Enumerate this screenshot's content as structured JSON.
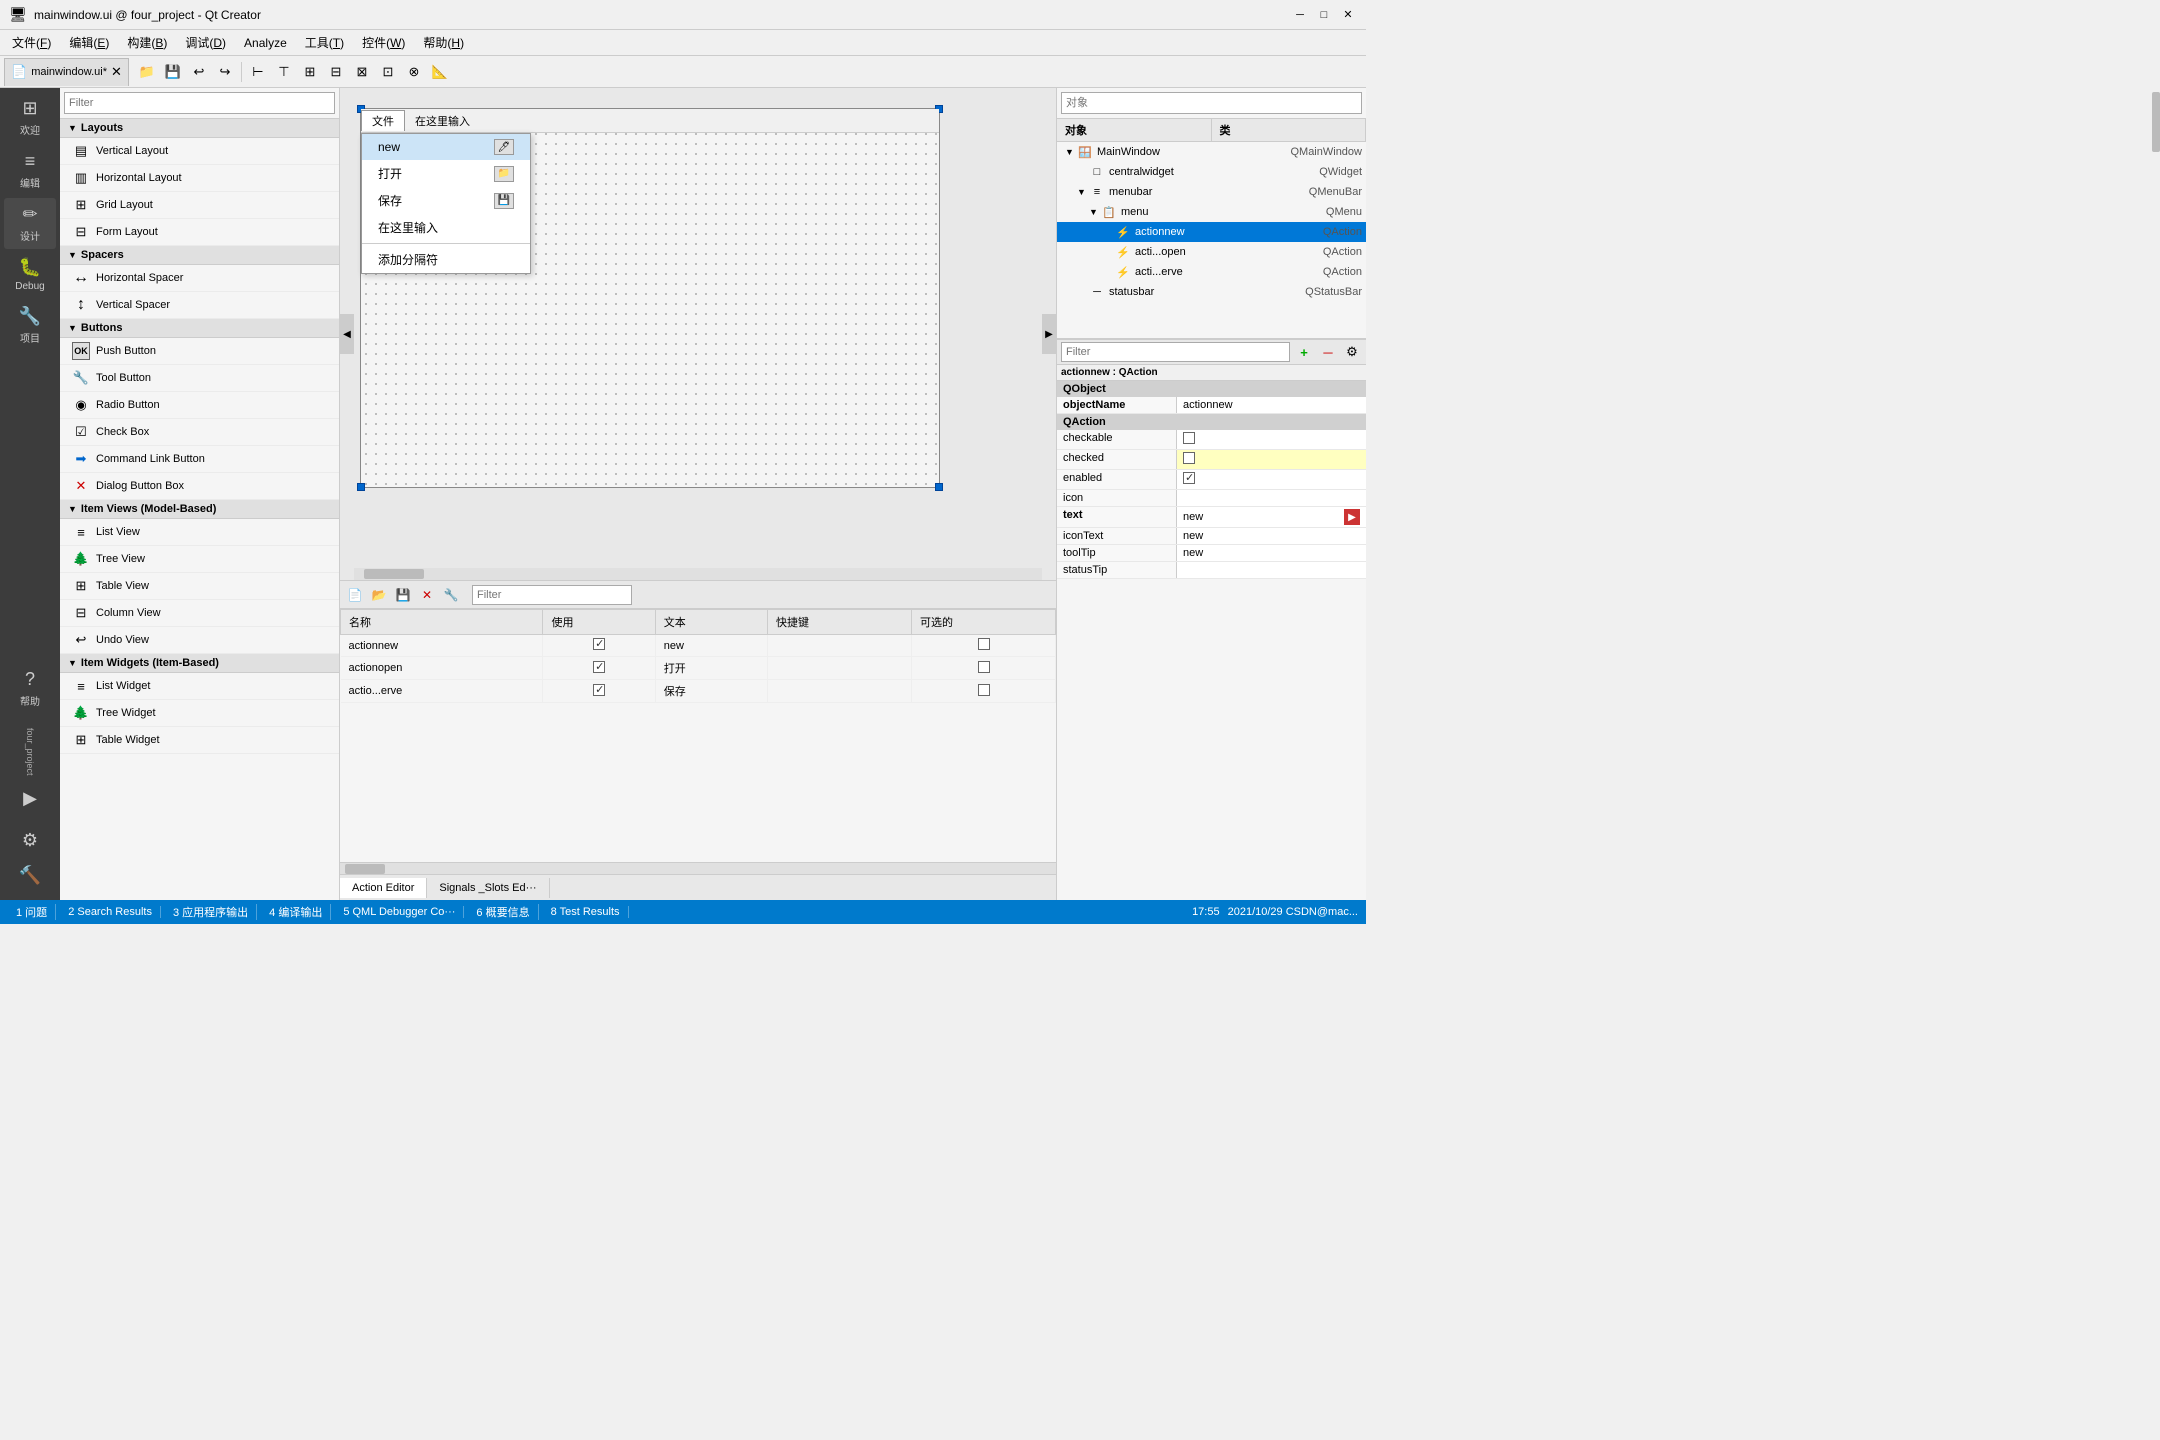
{
  "titleBar": {
    "title": "mainwindow.ui @ four_project - Qt Creator",
    "minimize": "─",
    "maximize": "□",
    "close": "✕"
  },
  "menuBar": {
    "items": [
      {
        "label": "文件(F)",
        "underline": "F"
      },
      {
        "label": "编辑(E)",
        "underline": "E"
      },
      {
        "label": "构建(B)",
        "underline": "B"
      },
      {
        "label": "调试(D)",
        "underline": "D"
      },
      {
        "label": "Analyze",
        "underline": ""
      },
      {
        "label": "工具(T)",
        "underline": "T"
      },
      {
        "label": "控件(W)",
        "underline": "W"
      },
      {
        "label": "帮助(H)",
        "underline": "H"
      }
    ]
  },
  "docTab": {
    "label": "mainwindow.ui*",
    "modified": true
  },
  "sidebarIcons": [
    {
      "name": "welcome",
      "symbol": "⊞",
      "label": "欢迎"
    },
    {
      "name": "edit",
      "symbol": "≡",
      "label": "编辑"
    },
    {
      "name": "design",
      "symbol": "✏",
      "label": "设计"
    },
    {
      "name": "debug",
      "symbol": "🐛",
      "label": "Debug"
    },
    {
      "name": "project",
      "symbol": "🔧",
      "label": "项目"
    },
    {
      "name": "help",
      "symbol": "?",
      "label": "帮助"
    }
  ],
  "widgetPanel": {
    "filterPlaceholder": "Filter",
    "categories": [
      {
        "name": "Layouts",
        "items": [
          {
            "label": "Vertical Layout",
            "icon": "▤"
          },
          {
            "label": "Horizontal Layout",
            "icon": "▥"
          },
          {
            "label": "Grid Layout",
            "icon": "⊞"
          },
          {
            "label": "Form Layout",
            "icon": "⊟"
          }
        ]
      },
      {
        "name": "Spacers",
        "items": [
          {
            "label": "Horizontal Spacer",
            "icon": "↔"
          },
          {
            "label": "Vertical Spacer",
            "icon": "↕"
          }
        ]
      },
      {
        "name": "Buttons",
        "items": [
          {
            "label": "Push Button",
            "icon": "OK"
          },
          {
            "label": "Tool Button",
            "icon": "🔧"
          },
          {
            "label": "Radio Button",
            "icon": "◉"
          },
          {
            "label": "Check Box",
            "icon": "☑"
          },
          {
            "label": "Command Link Button",
            "icon": "➡"
          },
          {
            "label": "Dialog Button Box",
            "icon": "✕"
          }
        ]
      },
      {
        "name": "Item Views (Model-Based)",
        "items": [
          {
            "label": "List View",
            "icon": "≡"
          },
          {
            "label": "Tree View",
            "icon": "🌲"
          },
          {
            "label": "Table View",
            "icon": "⊞"
          },
          {
            "label": "Column View",
            "icon": "⊟"
          },
          {
            "label": "Undo View",
            "icon": "↩"
          }
        ]
      },
      {
        "name": "Item Widgets (Item-Based)",
        "items": [
          {
            "label": "List Widget",
            "icon": "≡"
          },
          {
            "label": "Tree Widget",
            "icon": "🌲"
          },
          {
            "label": "Table Widget",
            "icon": "⊞"
          }
        ]
      }
    ]
  },
  "canvas": {
    "menuTabs": [
      {
        "label": "文件",
        "active": true
      },
      {
        "label": "在这里输入",
        "active": false
      }
    ],
    "dropdown": {
      "items": [
        {
          "label": "new",
          "shortcut": "",
          "hasIcon": true,
          "separator": false
        },
        {
          "label": "打开",
          "shortcut": "",
          "hasIcon": true,
          "separator": false
        },
        {
          "label": "保存",
          "shortcut": "",
          "hasIcon": true,
          "separator": false
        },
        {
          "label": "在这里输入",
          "shortcut": "",
          "hasIcon": false,
          "separator": false
        },
        {
          "label": "添加分隔符",
          "shortcut": "",
          "hasIcon": false,
          "separator": false
        }
      ]
    }
  },
  "actionEditor": {
    "filterPlaceholder": "Filter",
    "columns": [
      "名称",
      "使用",
      "文本",
      "快捷键",
      "可选的"
    ],
    "rows": [
      {
        "name": "actionnew",
        "used": true,
        "text": "new",
        "shortcut": "",
        "checkable": false
      },
      {
        "name": "actionopen",
        "used": true,
        "text": "打开",
        "shortcut": "",
        "checkable": false
      },
      {
        "name": "actio...erve",
        "used": true,
        "text": "保存",
        "shortcut": "",
        "checkable": false
      }
    ],
    "tabs": [
      {
        "label": "Action Editor",
        "active": true
      },
      {
        "label": "Signals _Slots Ed···",
        "active": false
      }
    ]
  },
  "objectTree": {
    "header": {
      "col1": "对象",
      "col2": "类"
    },
    "rows": [
      {
        "indent": 0,
        "expand": true,
        "icon": "🪟",
        "name": "MainWindow",
        "class": "QMainWindow",
        "selected": false
      },
      {
        "indent": 1,
        "expand": false,
        "icon": "□",
        "name": "centralwidget",
        "class": "QWidget",
        "selected": false
      },
      {
        "indent": 1,
        "expand": true,
        "icon": "≡",
        "name": "menubar",
        "class": "QMenuBar",
        "selected": false
      },
      {
        "indent": 2,
        "expand": true,
        "icon": "📋",
        "name": "menu",
        "class": "QMenu",
        "selected": false
      },
      {
        "indent": 3,
        "expand": false,
        "icon": "⚡",
        "name": "actionnew",
        "class": "QAction",
        "selected": false
      },
      {
        "indent": 3,
        "expand": false,
        "icon": "⚡",
        "name": "acti...open",
        "class": "QAction",
        "selected": false
      },
      {
        "indent": 3,
        "expand": false,
        "icon": "⚡",
        "name": "acti...erve",
        "class": "QAction",
        "selected": false
      },
      {
        "indent": 1,
        "expand": false,
        "icon": "─",
        "name": "statusbar",
        "class": "QStatusBar",
        "selected": false
      }
    ]
  },
  "propsPanel": {
    "caption": "actionnew : QAction",
    "filterPlaceholder": "Filter",
    "groups": [
      {
        "name": "QObject",
        "props": [
          {
            "name": "objectName",
            "value": "actionnew",
            "bold": true,
            "yellow": false
          }
        ]
      },
      {
        "name": "QAction",
        "props": [
          {
            "name": "checkable",
            "value": "",
            "bold": false,
            "yellow": false,
            "checkbox": true,
            "checked": false
          },
          {
            "name": "checked",
            "value": "",
            "bold": false,
            "yellow": true,
            "checkbox": true,
            "checked": false
          },
          {
            "name": "enabled",
            "value": "✓",
            "bold": false,
            "yellow": false,
            "checkbox": true,
            "checked": true
          },
          {
            "name": "icon",
            "value": "",
            "bold": false,
            "yellow": false
          },
          {
            "name": "text",
            "value": "new",
            "bold": true,
            "yellow": false,
            "hasEditBtn": true
          },
          {
            "name": "iconText",
            "value": "new",
            "bold": false,
            "yellow": false
          },
          {
            "name": "toolTip",
            "value": "new",
            "bold": false,
            "yellow": false
          },
          {
            "name": "statusTip",
            "value": "",
            "bold": false,
            "yellow": false
          }
        ]
      }
    ]
  },
  "statusBar": {
    "items": [
      "1 问题",
      "2 Search Results",
      "3 应用程序输出",
      "4 编译输出",
      "5 QML Debugger Co···",
      "6 概要信息",
      "8 Test Results"
    ],
    "rightInfo": "17:55",
    "date": "2021/10/29 CSDN@mac..."
  }
}
